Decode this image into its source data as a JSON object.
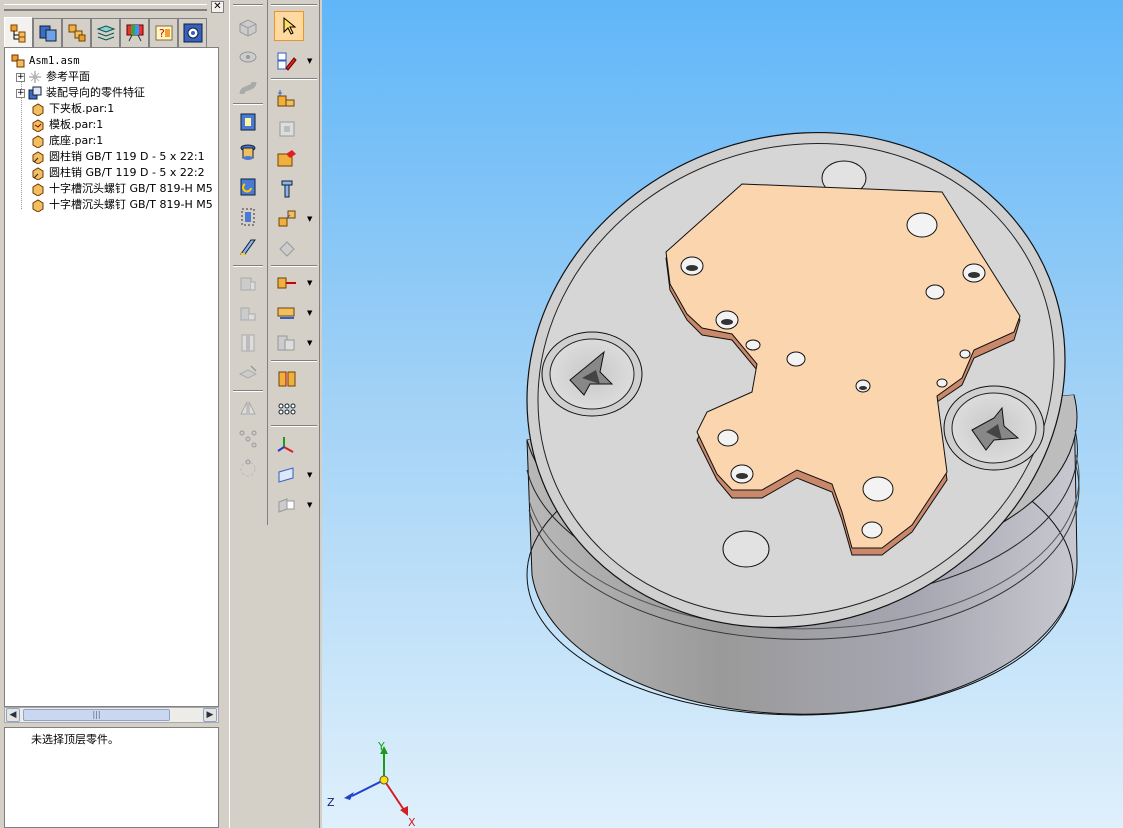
{
  "feature_tree": {
    "root": "Asm1.asm",
    "items": [
      {
        "label": "参考平面",
        "expandable": true
      },
      {
        "label": "装配导向的零件特征",
        "expandable": true
      },
      {
        "label": "下夹板.par:1"
      },
      {
        "label": "模板.par:1"
      },
      {
        "label": "底座.par:1"
      },
      {
        "label": "圆柱销 GB/T 119 D - 5 x 22:1"
      },
      {
        "label": "圆柱销 GB/T 119 D - 5 x 22:2"
      },
      {
        "label": "十字槽沉头螺钉 GB/T 819-H M5"
      },
      {
        "label": "十字槽沉头螺钉 GB/T 819-H M5"
      }
    ]
  },
  "status_message": "未选择顶层零件。",
  "tabs": [
    "assembly-tree-icon",
    "parts-library-icon",
    "assembly-parts-icon",
    "layers-icon",
    "view-style-icon",
    "properties-icon",
    "settings-icon"
  ],
  "axes": {
    "x": "X",
    "y": "Y",
    "z": "Z"
  },
  "colors": {
    "viewport_top": "#60b6f8",
    "viewport_bottom": "#dff0fb",
    "plate": "#f9d4a8",
    "base": "#d3d3d3",
    "select_highlight": "#ffd9a0"
  }
}
